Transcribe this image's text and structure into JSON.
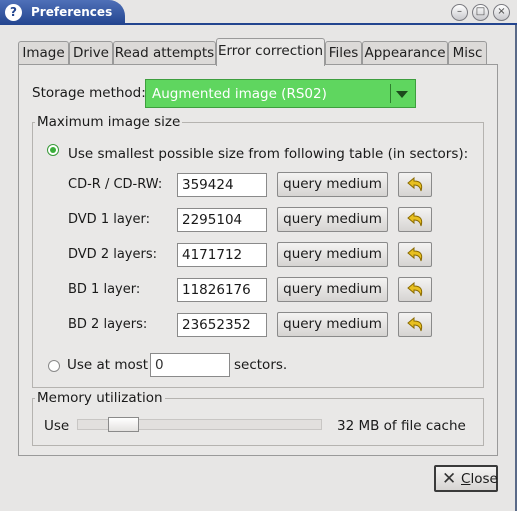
{
  "window": {
    "title": "Preferences",
    "controls": [
      "minimize",
      "maximize",
      "close"
    ]
  },
  "tabs": [
    "Image",
    "Drive",
    "Read attempts",
    "Error correction",
    "Files",
    "Appearance",
    "Misc"
  ],
  "active_tab": "Error correction",
  "storage": {
    "label": "Storage method:",
    "value": "Augmented image (RS02)"
  },
  "max_size": {
    "title": "Maximum image size",
    "table_option": "Use smallest possible size from following table (in sectors):",
    "table_selected": true,
    "rows": [
      {
        "label": "CD-R / CD-RW:",
        "value": "359424",
        "button": "query medium"
      },
      {
        "label": "DVD 1 layer:",
        "value": "2295104",
        "button": "query medium"
      },
      {
        "label": "DVD 2 layers:",
        "value": "4171712",
        "button": "query medium"
      },
      {
        "label": "BD 1 layer:",
        "value": "11826176",
        "button": "query medium"
      },
      {
        "label": "BD 2 layers:",
        "value": "23652352",
        "button": "query medium"
      }
    ],
    "at_most_prefix": "Use at most",
    "at_most_value": "0",
    "at_most_suffix": "sectors."
  },
  "memory": {
    "title": "Memory utilization",
    "use_label": "Use",
    "slider_fraction": 0.15,
    "value_text": "32 MB of file cache"
  },
  "close_button": {
    "underlined": "C",
    "rest": "lose"
  },
  "colors": {
    "title_bar": "#23458f",
    "combo_bg": "#5fd65f",
    "revert_arrow": "#e8c020"
  },
  "icons": {
    "revert": "revert-arrow-icon",
    "close": "close-x-icon",
    "app": "app-logo-icon"
  }
}
